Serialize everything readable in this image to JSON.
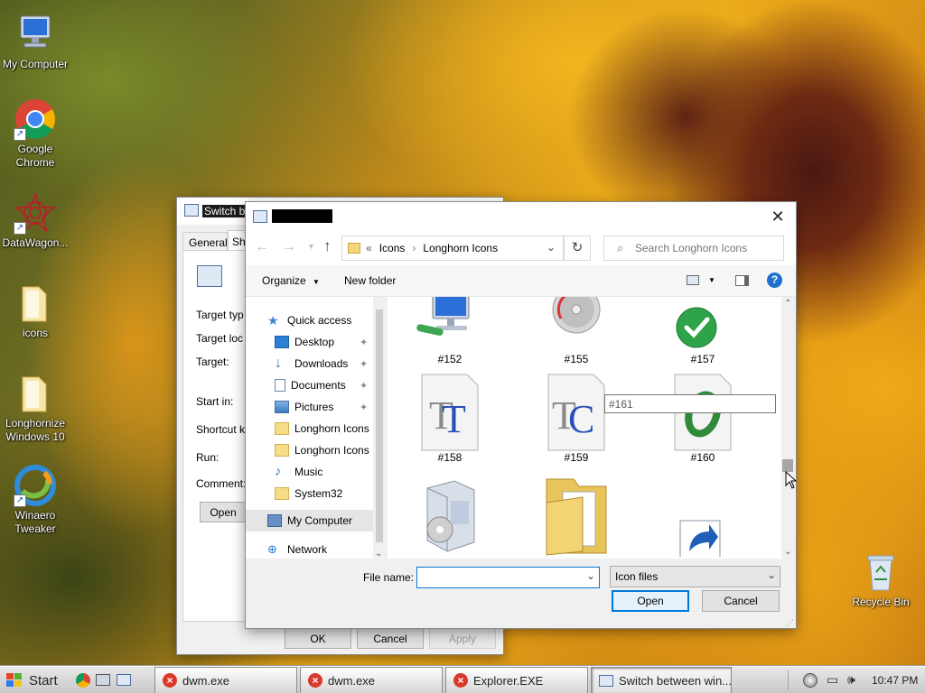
{
  "desktop": {
    "icons": [
      {
        "label": "My Computer"
      },
      {
        "label": "Google Chrome"
      },
      {
        "label": "DataWagon..."
      },
      {
        "label": "icons"
      },
      {
        "label": "Longhornize Windows 10"
      },
      {
        "label": "Winaero Tweaker"
      },
      {
        "label": "Recycle Bin"
      }
    ]
  },
  "props_dialog": {
    "title": "Switch b",
    "tabs": [
      "General",
      "Sh"
    ],
    "fields": [
      "Target typ",
      "Target loc",
      "Target:",
      "Start in:",
      "Shortcut k",
      "Run:",
      "Comment:"
    ],
    "open_button": "Open",
    "ok": "OK",
    "cancel": "Cancel",
    "apply": "Apply"
  },
  "file_dialog": {
    "breadcrumb": {
      "chevron": "«",
      "parts": [
        "Icons",
        "Longhorn Icons"
      ]
    },
    "search_placeholder": "Search Longhorn Icons",
    "toolbar": {
      "organize": "Organize",
      "new_folder": "New folder"
    },
    "nav": [
      {
        "label": "Quick access",
        "icon": "star-icon"
      },
      {
        "label": "Desktop",
        "icon": "desktop-icon",
        "pinned": true
      },
      {
        "label": "Downloads",
        "icon": "download-icon",
        "pinned": true
      },
      {
        "label": "Documents",
        "icon": "document-icon",
        "pinned": true
      },
      {
        "label": "Pictures",
        "icon": "picture-icon",
        "pinned": true
      },
      {
        "label": "Longhorn Icons",
        "icon": "folder-icon"
      },
      {
        "label": "Longhorn Icons",
        "icon": "folder-icon"
      },
      {
        "label": "Music",
        "icon": "music-icon"
      },
      {
        "label": "System32",
        "icon": "folder-icon"
      },
      {
        "label": "My Computer",
        "icon": "computer-icon",
        "selected": true
      },
      {
        "label": "Network",
        "icon": "network-icon"
      }
    ],
    "files": [
      {
        "label": "#152",
        "icon": "network-computer-icon"
      },
      {
        "label": "#155",
        "icon": "cd-drive-icon"
      },
      {
        "label": "#157",
        "icon": "green-check-icon"
      },
      {
        "label": "#158",
        "icon": "font-truetype-icon"
      },
      {
        "label": "#159",
        "icon": "font-compressed-icon"
      },
      {
        "label": "#160",
        "icon": "font-opentype-icon"
      },
      {
        "label": "",
        "icon": "software-box-icon"
      },
      {
        "label": "",
        "icon": "open-folder-icon"
      },
      {
        "label": "",
        "icon": "shortcut-icon"
      }
    ],
    "tooltip": "#161",
    "filename_label": "File name:",
    "filename_value": "",
    "filetype_value": "Icon files",
    "open": "Open",
    "cancel": "Cancel"
  },
  "taskbar": {
    "start": "Start",
    "buttons": [
      {
        "label": "dwm.exe",
        "icon": "error-icon"
      },
      {
        "label": "dwm.exe",
        "icon": "error-icon"
      },
      {
        "label": "Explorer.EXE",
        "icon": "error-icon"
      },
      {
        "label": "Switch between win...",
        "icon": "app-window-icon"
      }
    ],
    "clock": "10:47 PM"
  }
}
